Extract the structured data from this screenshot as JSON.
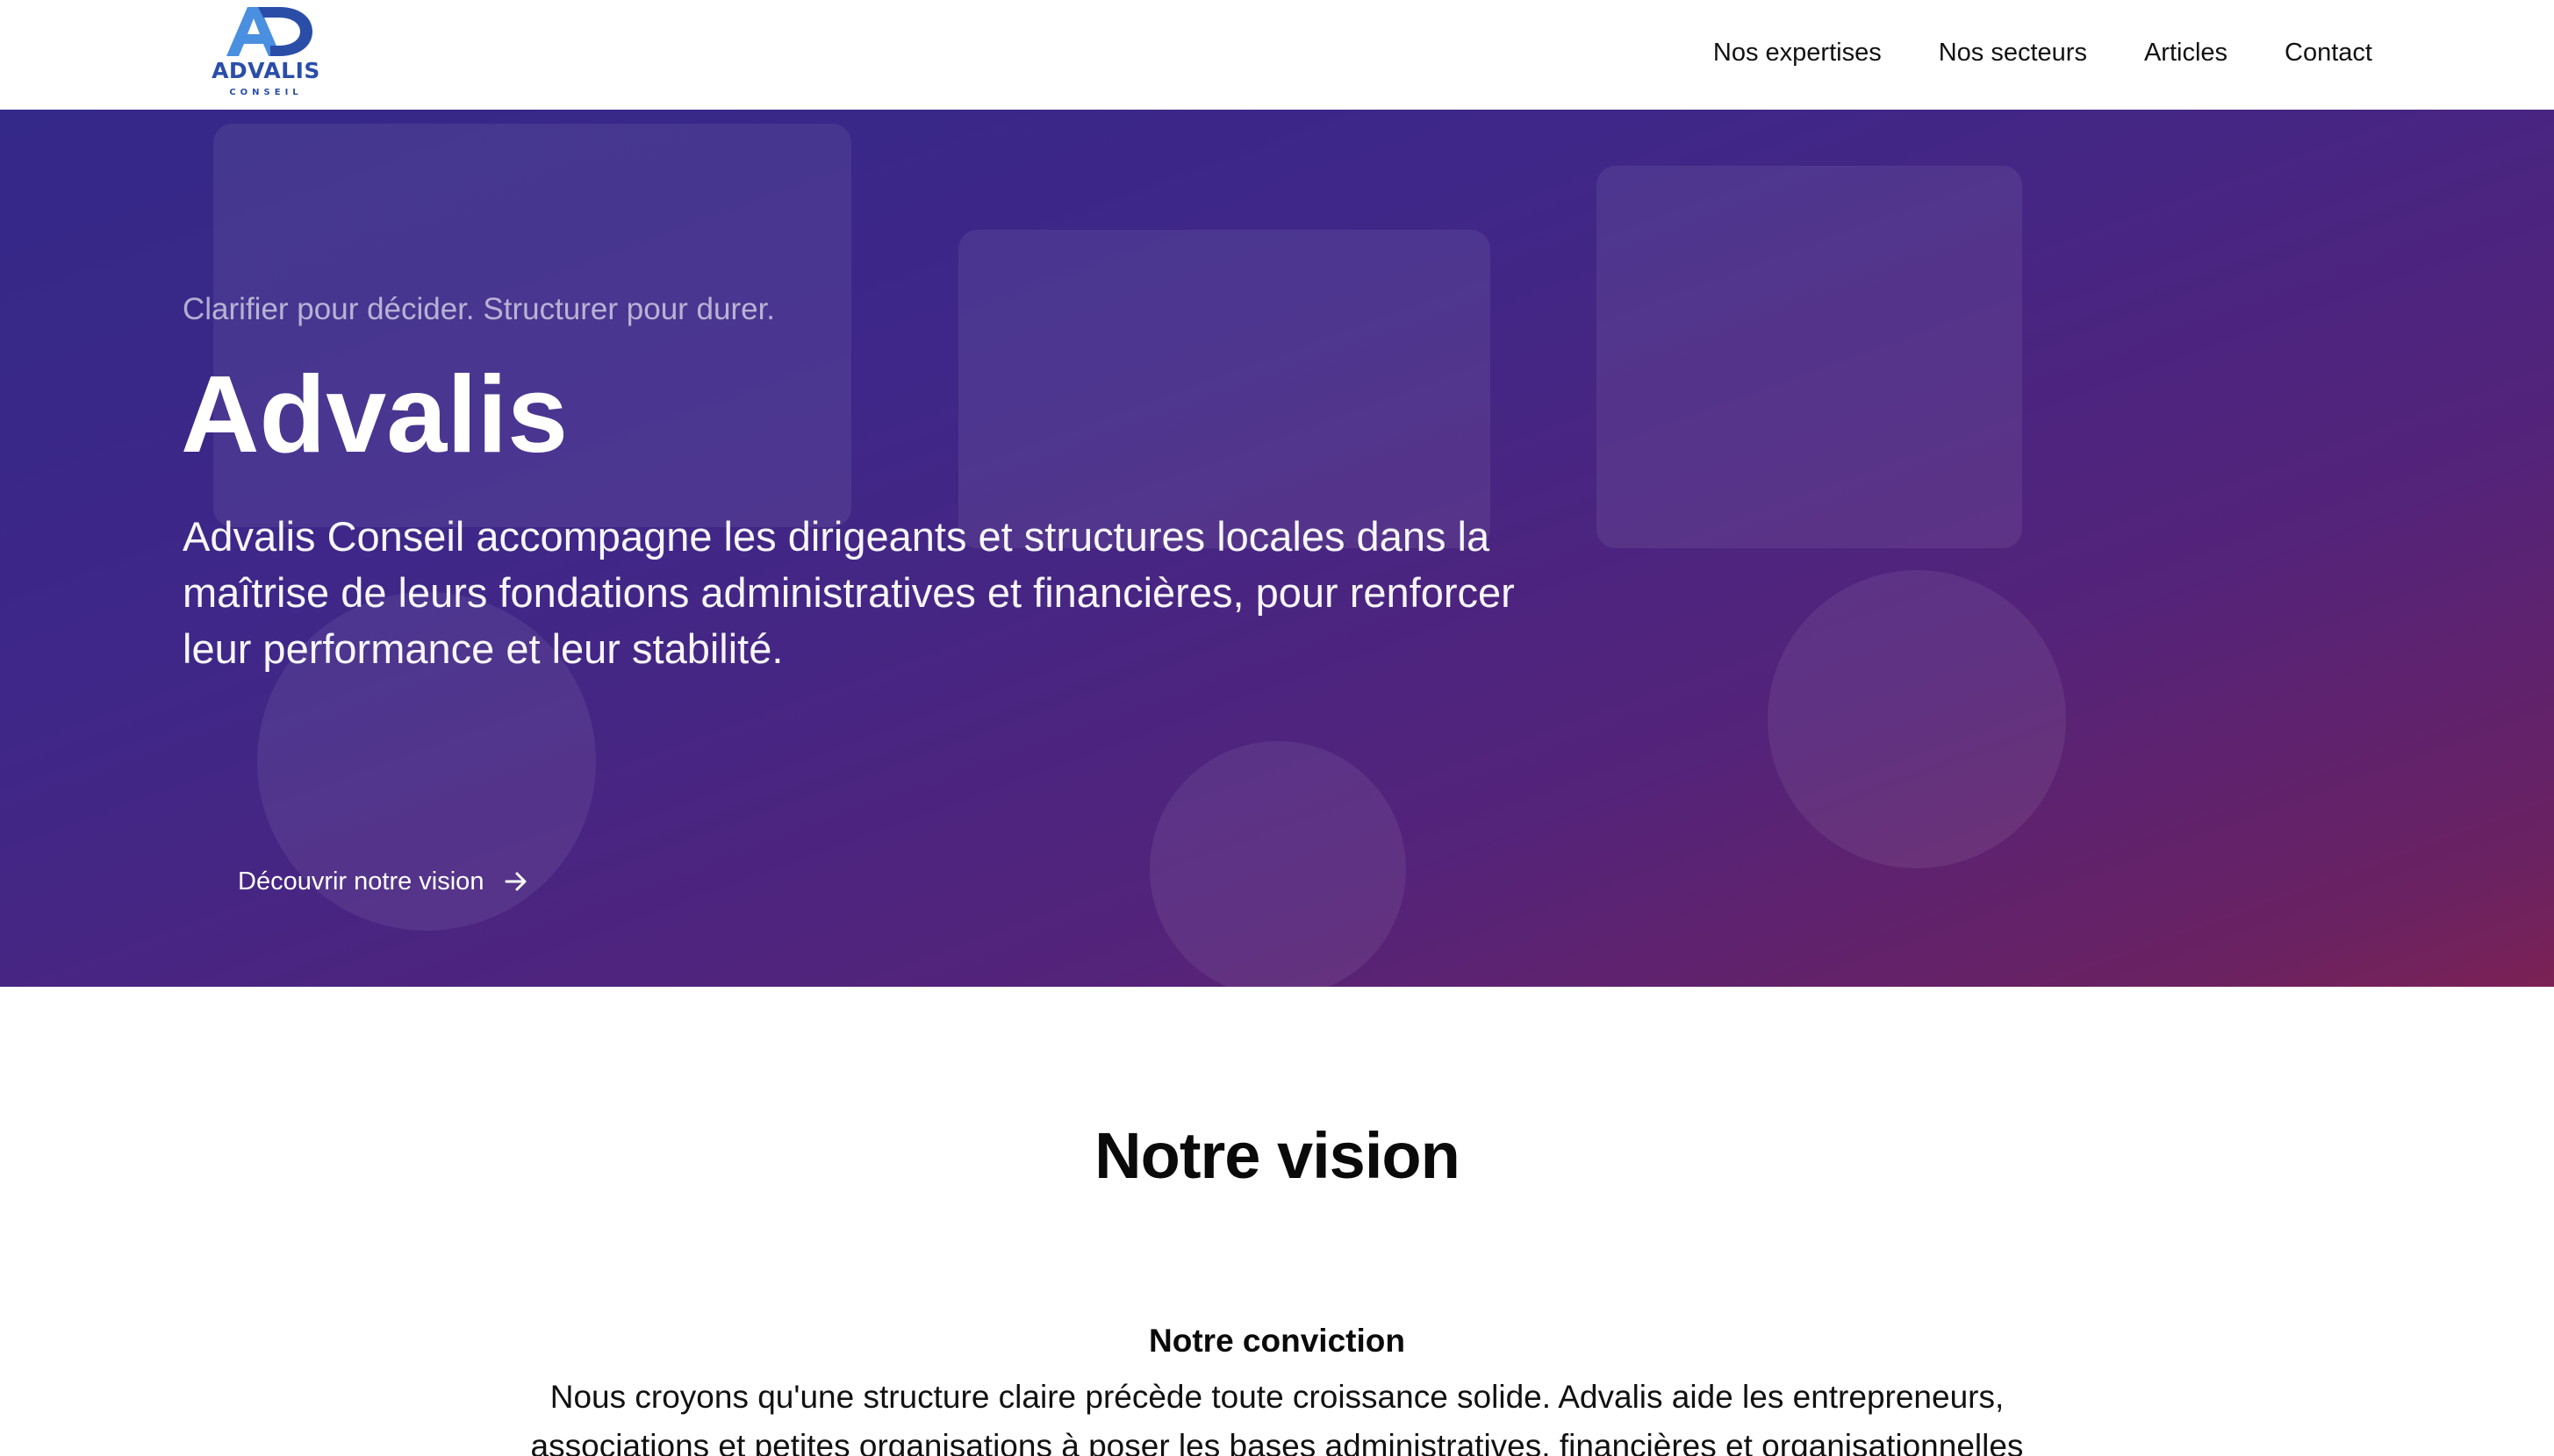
{
  "header": {
    "logo": {
      "mark": "AD",
      "word": "ADVALIS",
      "sub": "CONSEIL",
      "color": "#2a4ea8"
    },
    "nav": [
      {
        "label": "Nos expertises"
      },
      {
        "label": "Nos secteurs"
      },
      {
        "label": "Articles"
      },
      {
        "label": "Contact"
      }
    ]
  },
  "hero": {
    "tagline": "Clarifier pour décider. Structurer pour durer.",
    "title": "Advalis",
    "description": "Advalis Conseil accompagne les dirigeants et structures locales dans la maîtrise de leurs fondations administratives et financières, pour renforcer leur performance et leur stabilité.",
    "cta_label": "Découvrir notre vision",
    "cta_icon": "arrow-right-icon",
    "gradient_colors": [
      "#342888",
      "#54237a",
      "#7b2155"
    ]
  },
  "vision": {
    "title": "Notre vision",
    "conviction_title": "Notre conviction",
    "conviction_text": "Nous croyons qu'une structure claire précède toute croissance solide. Advalis aide les entrepreneurs, associations et petites organisations à poser les bases administratives, financières et organisationnelles"
  }
}
